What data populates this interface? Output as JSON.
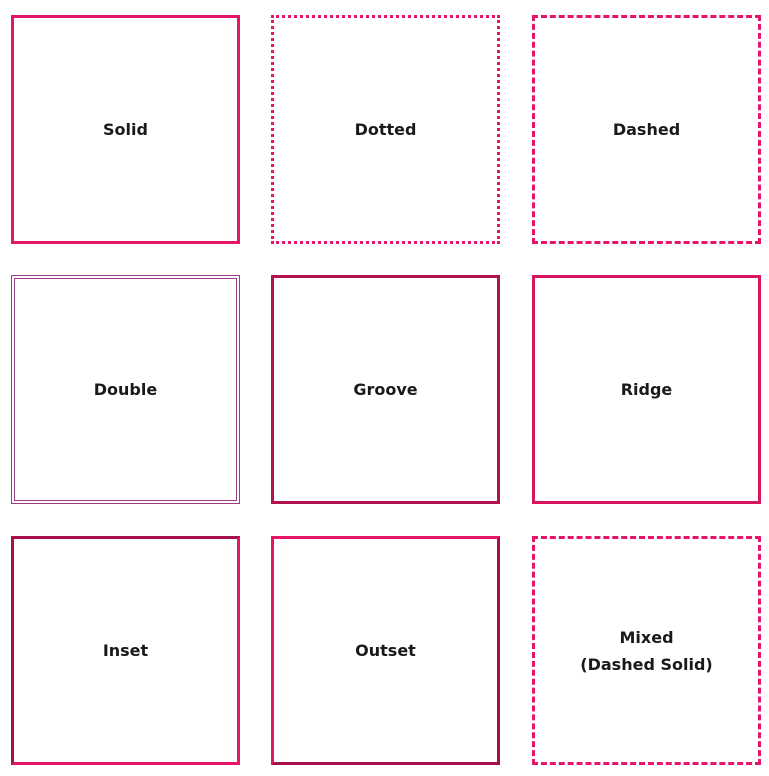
{
  "boxes": {
    "solid": {
      "label": "Solid"
    },
    "dotted": {
      "label": "Dotted"
    },
    "dashed": {
      "label": "Dashed"
    },
    "double": {
      "label": "Double"
    },
    "groove": {
      "label": "Groove"
    },
    "ridge": {
      "label": "Ridge"
    },
    "inset": {
      "label": "Inset"
    },
    "outset": {
      "label": "Outset"
    },
    "mixed": {
      "label": "Mixed\n(Dashed Solid)"
    }
  },
  "colors": {
    "primary_border": "#e5166a",
    "dark_border": "#a8104b",
    "double_border": "#9b3a8c",
    "text": "#1a1a1a",
    "background": "#ffffff"
  }
}
